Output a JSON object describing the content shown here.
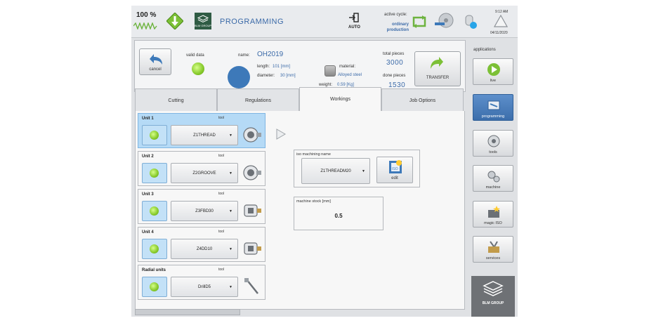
{
  "header": {
    "zoom": "100 %",
    "logo_text": "BLM GROUP",
    "title": "PROGRAMMING",
    "mode_label": "AUTO",
    "active_cycle_title": "active cycle:",
    "active_cycle_line1": "ordinary",
    "active_cycle_line2": "production",
    "time": "9:12 AM",
    "date": "04/11/2020"
  },
  "info": {
    "cancel_label": "cancel",
    "valid_data_label": "valid data",
    "name_label": "name:",
    "name_value": "OH2019",
    "length_label": "length:",
    "length_value": "101 [mm]",
    "diameter_label": "diameter:",
    "diameter_value": "30 [mm]",
    "material_label": "material:",
    "material_value": "Alloyed steel",
    "weight_label": "weight:",
    "weight_value": "0.59 [Kg]",
    "total_pieces_label": "total pieces",
    "total_pieces_value": "3000",
    "done_pieces_label": "done pieces",
    "done_pieces_value": "1530",
    "transfer_label": "TRANSFER"
  },
  "tabs": [
    {
      "label": "Cutting",
      "active": false
    },
    {
      "label": "Regulations",
      "active": false
    },
    {
      "label": "Workings",
      "active": true
    },
    {
      "label": "Job Options",
      "active": false
    }
  ],
  "units": [
    {
      "name": "Unit 1",
      "tool_label": "tool",
      "tool": "Z1THREAD",
      "selected": true
    },
    {
      "name": "Unit 2",
      "tool_label": "tool",
      "tool": "Z2GROOVE",
      "selected": false
    },
    {
      "name": "Unit 3",
      "tool_label": "tool",
      "tool": "Z3FBD30",
      "selected": false
    },
    {
      "name": "Unit 4",
      "tool_label": "tool",
      "tool": "Z4DD10",
      "selected": false
    },
    {
      "name": "Radial units",
      "tool_label": "tool",
      "tool": "DrillD5",
      "selected": false
    }
  ],
  "iso": {
    "title": "iso machining name",
    "value": "Z1THREADM20",
    "edit_label": "edit",
    "iso_badge": "ISO"
  },
  "stock": {
    "title": "machine stock [mm]",
    "value": "0.5"
  },
  "sidebar": {
    "title": "applications",
    "items": [
      {
        "label": "live",
        "icon": "play-icon",
        "active": false
      },
      {
        "label": "programming",
        "icon": "programming-icon",
        "active": true
      },
      {
        "label": "tools",
        "icon": "tools-icon",
        "active": false
      },
      {
        "label": "machine",
        "icon": "gears-icon",
        "active": false
      },
      {
        "label": "magic ISO",
        "icon": "magic-iso-icon",
        "active": false
      },
      {
        "label": "services",
        "icon": "services-icon",
        "active": false
      }
    ]
  },
  "footer": {
    "logo_text": "BLM GROUP"
  },
  "colors": {
    "accent_blue": "#3b6aa8",
    "led_green": "#86c92a",
    "selected_row": "#b5daf6",
    "sidebar_active": "#3c6eab"
  }
}
